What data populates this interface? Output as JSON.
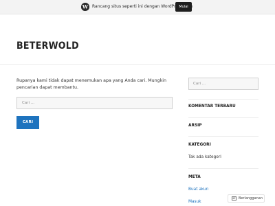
{
  "wp_bar": {
    "text": "Rancang situs seperti ini dengan WordPress.com",
    "button": "Mulai"
  },
  "site": {
    "title": "BETERWOLD"
  },
  "main": {
    "message": "Rupanya kami tidak dapat menemukan apa yang Anda cari. Mungkin pencarian dapat membantu.",
    "search_placeholder": "Cari ...",
    "search_button": "CARI"
  },
  "sidebar": {
    "search_placeholder": "Cari ...",
    "recent_comments_title": "KOMENTAR TERBARU",
    "archives_title": "ARSIP",
    "categories_title": "KATEGORI",
    "categories_empty": "Tak ada kategori",
    "meta_title": "META",
    "meta_links": [
      "Buat akun",
      "Masuk"
    ]
  },
  "subscribe": {
    "label": "Berlangganan"
  },
  "colors": {
    "accent": "#1e73be",
    "wp_button": "#1e1e1e"
  }
}
